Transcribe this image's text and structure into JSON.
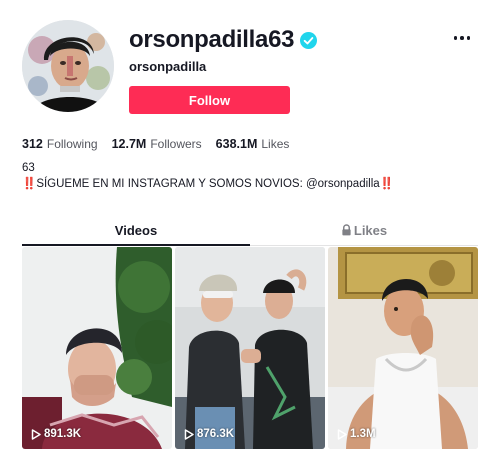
{
  "profile": {
    "username": "orsonpadilla63",
    "nickname": "orsonpadilla",
    "verified": true,
    "follow_label": "Follow",
    "more_icon": "ellipsis-icon",
    "avatar_icon": "profile-avatar"
  },
  "stats": [
    {
      "value": "312",
      "label": "Following"
    },
    {
      "value": "12.7M",
      "label": "Followers"
    },
    {
      "value": "638.1M",
      "label": "Likes"
    }
  ],
  "bio": {
    "line1": "63",
    "line2": "‼️SÍGUEME EN MI INSTAGRAM Y SOMOS NOVIOS: @orsonpadilla‼️"
  },
  "tabs": [
    {
      "label": "Videos",
      "active": true
    },
    {
      "label": "Likes",
      "active": false,
      "icon": "lock-icon"
    }
  ],
  "videos": [
    {
      "views": "891.3K"
    },
    {
      "views": "876.3K"
    },
    {
      "views": "1.3M"
    }
  ],
  "colors": {
    "follow_button": "#fe2c55",
    "verified_badge": "#20d5ec",
    "text": "#161823"
  }
}
